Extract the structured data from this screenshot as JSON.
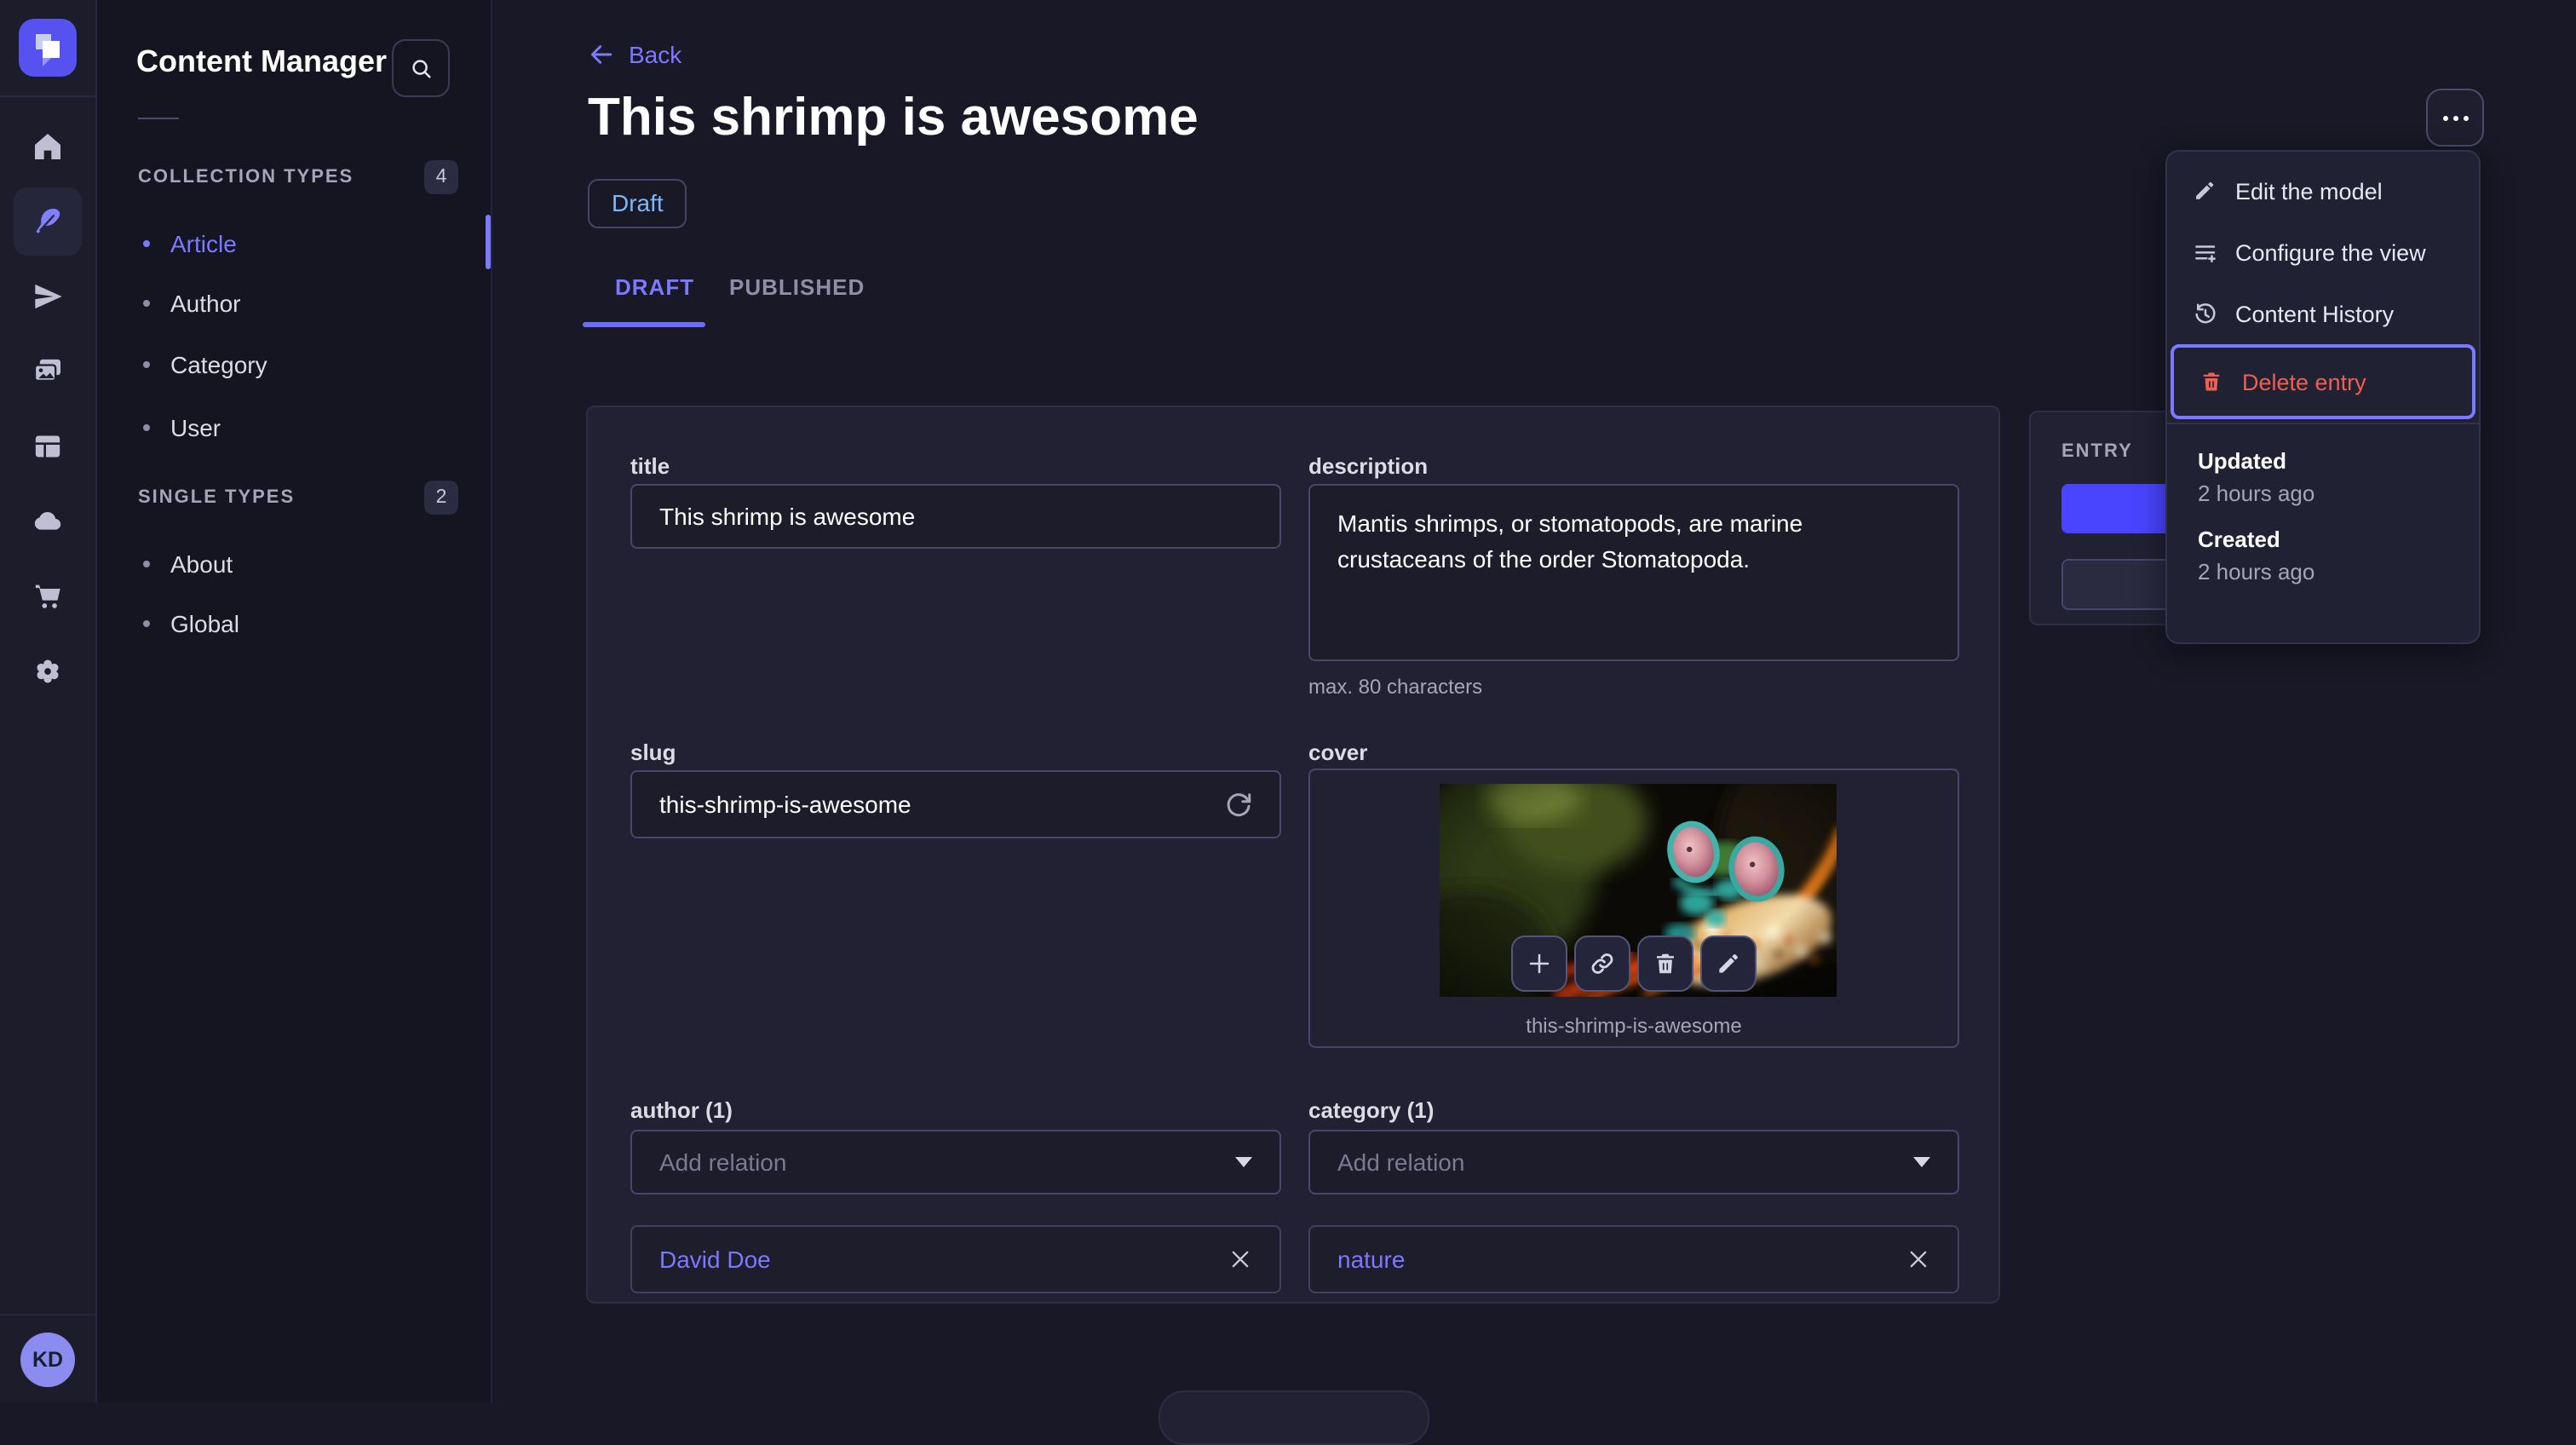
{
  "rail": {
    "logo_icon": "strapi-logo",
    "items": [
      {
        "icon": "home-icon",
        "active": false
      },
      {
        "icon": "feather-icon",
        "active": true
      },
      {
        "icon": "paper-plane-icon",
        "active": false
      },
      {
        "icon": "media-library-icon",
        "active": false
      },
      {
        "icon": "layout-builder-icon",
        "active": false
      },
      {
        "icon": "cloud-icon",
        "active": false
      },
      {
        "icon": "cart-icon",
        "active": false
      },
      {
        "icon": "gear-icon",
        "active": false
      }
    ],
    "avatar_initials": "KD"
  },
  "subnav": {
    "title": "Content Manager",
    "search_icon": "search-icon",
    "sections": [
      {
        "label": "COLLECTION TYPES",
        "count": "4",
        "items": [
          {
            "label": "Article",
            "active": true
          },
          {
            "label": "Author",
            "active": false
          },
          {
            "label": "Category",
            "active": false
          },
          {
            "label": "User",
            "active": false
          }
        ]
      },
      {
        "label": "SINGLE TYPES",
        "count": "2",
        "items": [
          {
            "label": "About",
            "active": false
          },
          {
            "label": "Global",
            "active": false
          }
        ]
      }
    ]
  },
  "header": {
    "back_label": "Back",
    "title": "This shrimp is awesome",
    "status_badge": "Draft",
    "tabs": [
      {
        "label": "DRAFT",
        "active": true
      },
      {
        "label": "PUBLISHED",
        "active": false
      }
    ]
  },
  "form": {
    "title_field": {
      "label": "title",
      "value": "This shrimp is awesome"
    },
    "description_field": {
      "label": "description",
      "value": "Mantis shrimps, or stomatopods, are marine crustaceans of the order Stomatopoda.",
      "hint": "max. 80 characters"
    },
    "slug_field": {
      "label": "slug",
      "value": "this-shrimp-is-awesome",
      "regenerate_icon": "refresh-icon"
    },
    "cover_field": {
      "label": "cover",
      "filename": "this-shrimp-is-awesome",
      "actions": [
        "plus-icon",
        "link-icon",
        "trash-icon",
        "pencil-icon"
      ]
    },
    "author_field": {
      "label": "author (1)",
      "placeholder": "Add relation",
      "relation": "David Doe"
    },
    "category_field": {
      "label": "category (1)",
      "placeholder": "Add relation",
      "relation": "nature"
    }
  },
  "entry_panel": {
    "label": "ENTRY"
  },
  "context_menu": {
    "items": [
      {
        "label": "Edit the model",
        "icon": "pencil-icon",
        "danger": false
      },
      {
        "label": "Configure the view",
        "icon": "configure-list-icon",
        "danger": false
      },
      {
        "label": "Content History",
        "icon": "history-icon",
        "danger": false
      },
      {
        "label": "Delete entry",
        "icon": "trash-icon",
        "danger": true,
        "highlighted": true
      }
    ],
    "meta": [
      {
        "label": "Updated",
        "value": "2 hours ago"
      },
      {
        "label": "Created",
        "value": "2 hours ago"
      }
    ]
  },
  "colors": {
    "primary": "#4945ff",
    "accent_text": "#7b79ff",
    "danger": "#ee5e52",
    "draft_status": "#7db8f5",
    "page_bg": "#181826",
    "card_bg": "#212134"
  }
}
